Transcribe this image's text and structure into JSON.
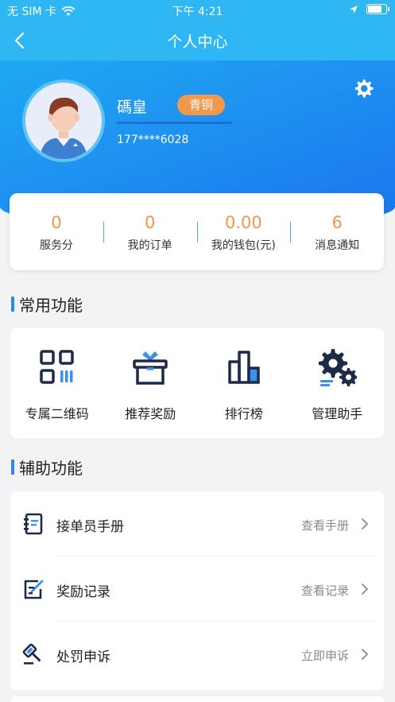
{
  "status_bar": {
    "carrier": "无 SIM 卡",
    "time": "下午 4:21"
  },
  "nav": {
    "title": "个人中心"
  },
  "profile": {
    "name": "碼皇",
    "level_badge": "青铜",
    "level_progress": 1.0,
    "phone": "177****6028"
  },
  "stats": [
    {
      "value": "0",
      "label": "服务分"
    },
    {
      "value": "0",
      "label": "我的订单"
    },
    {
      "value": "0.00",
      "label": "我的钱包(元)"
    },
    {
      "value": "6",
      "label": "消息通知"
    }
  ],
  "common_functions": {
    "title": "常用功能",
    "items": [
      {
        "label": "专属二维码",
        "icon": "qrcode-icon"
      },
      {
        "label": "推荐奖励",
        "icon": "gift-icon"
      },
      {
        "label": "排行榜",
        "icon": "ranking-icon"
      },
      {
        "label": "管理助手",
        "icon": "gears-icon"
      }
    ]
  },
  "aux_functions": {
    "title": "辅助功能",
    "items": [
      {
        "label": "接单员手册",
        "action": "查看手册",
        "icon": "handbook-icon"
      },
      {
        "label": "奖励记录",
        "action": "查看记录",
        "icon": "edit-record-icon"
      },
      {
        "label": "处罚申诉",
        "action": "立即申诉",
        "icon": "gavel-icon"
      }
    ]
  },
  "colors": {
    "primary": "#2fb7f3",
    "accent_orange": "#f0954a",
    "section_bar": "#2f86f0",
    "icon_navy": "#1e2a4a",
    "icon_blue": "#3d8ff0"
  }
}
